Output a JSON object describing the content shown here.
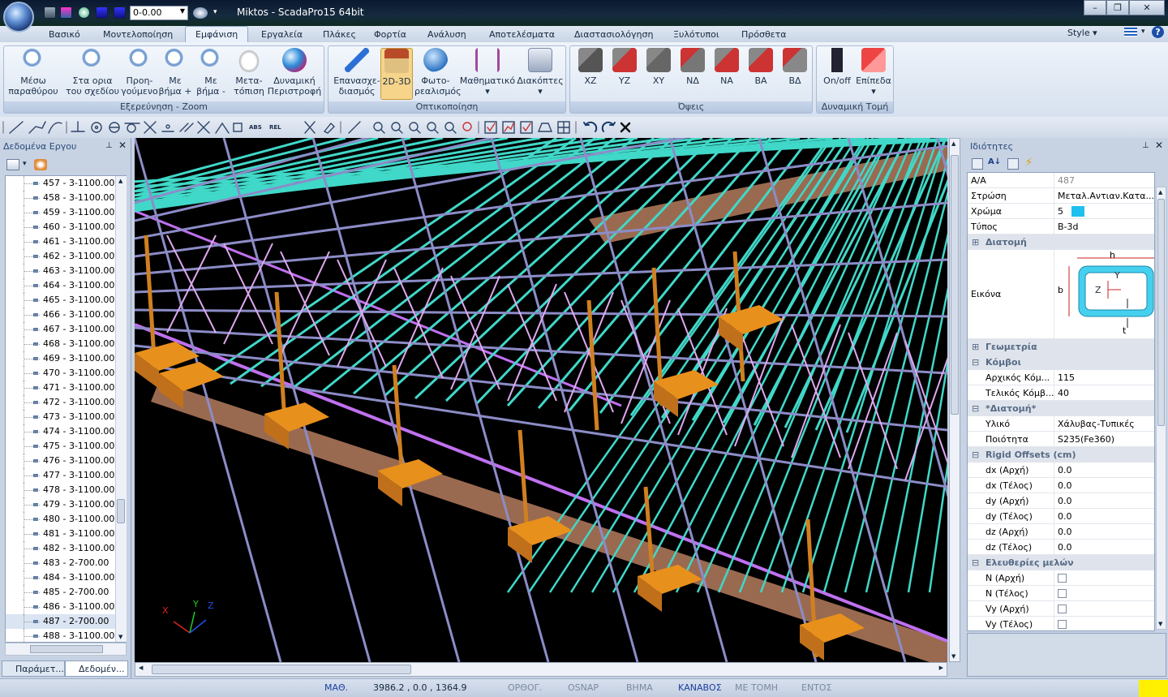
{
  "titlebar": {
    "layer_value": "0-0.00",
    "title": "Miktos - ScadaPro15 64bit",
    "buttons": {
      "minimize": "–",
      "maximize": "❐",
      "close": "✕"
    }
  },
  "menu": {
    "items": [
      "Βασικό",
      "Μοντελοποίηση",
      "Εμφάνιση",
      "Εργαλεία",
      "Πλάκες",
      "Φορτία",
      "Ανάλυση",
      "Αποτελέσματα",
      "Διαστασιολόγηση",
      "Ξυλότυποι",
      "Πρόσθετα"
    ],
    "active": "Εμφάνιση",
    "style_label": "Style",
    "help": "?"
  },
  "ribbon": {
    "zoom_group": {
      "label": "Εξερεύνηση - Zoom",
      "buttons": [
        {
          "l1": "Μέσω",
          "l2": "παραθύρου"
        },
        {
          "l1": "Στα ορια",
          "l2": "του σχεδίου"
        },
        {
          "l1": "Προη-",
          "l2": "γούμενο"
        },
        {
          "l1": "Με",
          "l2": "βήμα +"
        },
        {
          "l1": "Με",
          "l2": "βήμα -"
        },
        {
          "l1": "Μετα-",
          "l2": "τόπιση"
        },
        {
          "l1": "Δυναμική",
          "l2": "Περιστροφή"
        }
      ]
    },
    "view_group": {
      "label": "Οπτικοποίηση",
      "buttons": [
        {
          "l1": "Επανασχε-",
          "l2": "διασμός"
        },
        {
          "l1": "2D-3D",
          "l2": ""
        },
        {
          "l1": "Φωτο-",
          "l2": "ρεαλισμός"
        },
        {
          "l1": "Μαθηματικό",
          "l2": "▾"
        },
        {
          "l1": "Διακόπτες",
          "l2": "▾"
        }
      ]
    },
    "views_group": {
      "label": "Όψεις",
      "buttons": [
        "XZ",
        "YZ",
        "XY",
        "ΝΔ",
        "ΝΑ",
        "ΒΑ",
        "ΒΔ"
      ]
    },
    "section_group": {
      "label": "Δυναμική Τομή",
      "buttons": [
        {
          "l1": "On/off",
          "l2": ""
        },
        {
          "l1": "Επίπεδα",
          "l2": "▾"
        }
      ]
    }
  },
  "toolbar": {
    "abs_label": "ABS",
    "rel_label": "REL"
  },
  "left_panel": {
    "title": "Δεδομένα Εργου",
    "tree_items": [
      "457 - 3-1100.00",
      "458 - 3-1100.00",
      "459 - 3-1100.00",
      "460 - 3-1100.00",
      "461 - 3-1100.00",
      "462 - 3-1100.00",
      "463 - 3-1100.00",
      "464 - 3-1100.00",
      "465 - 3-1100.00",
      "466 - 3-1100.00",
      "467 - 3-1100.00",
      "468 - 3-1100.00",
      "469 - 3-1100.00",
      "470 - 3-1100.00",
      "471 - 3-1100.00",
      "472 - 3-1100.00",
      "473 - 3-1100.00",
      "474 - 3-1100.00",
      "475 - 3-1100.00",
      "476 - 3-1100.00",
      "477 - 3-1100.00",
      "478 - 3-1100.00",
      "479 - 3-1100.00",
      "480 - 3-1100.00",
      "481 - 3-1100.00",
      "482 - 3-1100.00",
      "483 - 2-700.00",
      "484 - 3-1100.00",
      "485 - 2-700.00",
      "486 - 3-1100.00",
      "487 - 2-700.00",
      "488 - 3-1100.00"
    ],
    "selected_item": "487 - 2-700.00",
    "tabs": [
      "Παράμετ...",
      "Δεδομέν..."
    ]
  },
  "viewport": {
    "axis_labels": {
      "x": "X",
      "y": "Y",
      "z": "Z"
    },
    "colors": {
      "background": "#000000",
      "truss": "#8c8cc8",
      "purlins": "#40d8c8",
      "bracing": "#e0a8f0",
      "columns": "#d08020",
      "footings": "#e8901c",
      "beams": "#9a6a50",
      "tie": "#c070f0"
    }
  },
  "right_panel": {
    "title": "Ιδιότητες",
    "rows": [
      {
        "k": "A/A",
        "v": "487",
        "grey": true
      },
      {
        "k": "Στρώση",
        "v": "Μεταλ.Αντιαν.Κατα..."
      },
      {
        "k": "Χρώμα",
        "v": "5"
      },
      {
        "k": "Τύπος",
        "v": "B-3d"
      }
    ],
    "cat_section": "Διατομή",
    "image_label": "Εικόνα",
    "section_image": {
      "h": "h",
      "b": "b",
      "y": "Y",
      "z": "Z",
      "t": "t"
    },
    "cat_geometry": "Γεωμετρία",
    "cat_nodes": "Κόμβοι",
    "node_rows": [
      {
        "k": "Αρχικός Κόμ...",
        "v": "115"
      },
      {
        "k": "Τελικός Κόμβ...",
        "v": "40"
      }
    ],
    "cat_section2": "*Διατομή*",
    "section_rows": [
      {
        "k": "Υλικό",
        "v": "Χάλυβας-Τυπικές"
      },
      {
        "k": "Ποιότητα",
        "v": "S235(Fe360)"
      }
    ],
    "cat_offsets": "Rigid Offsets (cm)",
    "offset_rows": [
      {
        "k": "dx (Αρχή)",
        "v": "0.0"
      },
      {
        "k": "dx (Τέλος)",
        "v": "0.0"
      },
      {
        "k": "dy (Αρχή)",
        "v": "0.0"
      },
      {
        "k": "dy (Τέλος)",
        "v": "0.0"
      },
      {
        "k": "dz (Αρχή)",
        "v": "0.0"
      },
      {
        "k": "dz (Τέλος)",
        "v": "0.0"
      }
    ],
    "cat_releases": "Ελευθερίες μελών",
    "release_rows": [
      "N (Αρχή)",
      "N (Τέλος)",
      "Vy (Αρχή)",
      "Vy (Τέλος)"
    ],
    "color_swatch": "#1ec0f0"
  },
  "status": {
    "math": "ΜΑΘ.",
    "coords": "3986.2 , 0.0 , 1364.9",
    "modes": [
      {
        "label": "ΟΡΘΟΓ.",
        "on": false
      },
      {
        "label": "OSNAP",
        "on": false
      },
      {
        "label": "ΒΗΜΑ",
        "on": false
      },
      {
        "label": "ΚΑΝΑΒΟΣ",
        "on": true
      },
      {
        "label": "ΜΕ ΤΟΜΗ",
        "on": false
      },
      {
        "label": "ΕΝΤΟΣ",
        "on": false
      }
    ]
  }
}
